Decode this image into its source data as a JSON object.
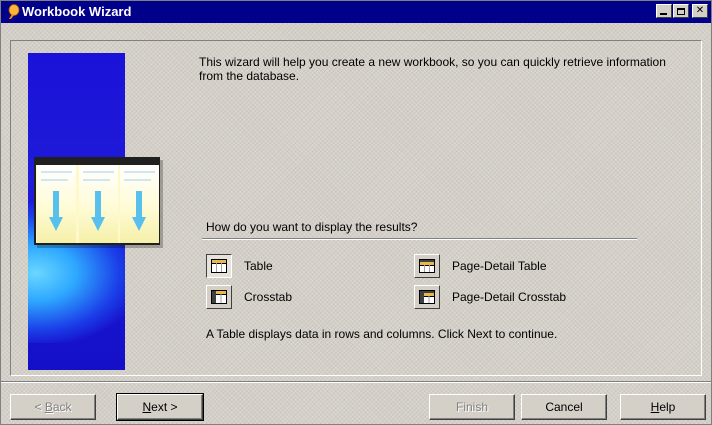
{
  "window": {
    "title": "Workbook Wizard",
    "controls": {
      "minimize": "_",
      "maximize": "□",
      "close": "×"
    }
  },
  "intro_text": "This wizard will help you create a new workbook, so you can quickly retrieve information from the database.",
  "question": "How do you want to display the results?",
  "options": [
    {
      "label": "Table",
      "icon": "table-layout-icon",
      "selected": true
    },
    {
      "label": "Page-Detail Table",
      "icon": "page-detail-table-icon",
      "selected": false
    },
    {
      "label": "Crosstab",
      "icon": "crosstab-layout-icon",
      "selected": false
    },
    {
      "label": "Page-Detail Crosstab",
      "icon": "page-detail-crosstab-icon",
      "selected": false
    }
  ],
  "hint": "A Table displays data in rows and columns. Click Next to continue.",
  "buttons": {
    "back": {
      "pre": "< ",
      "mn": "B",
      "post": "ack",
      "enabled": false
    },
    "next": {
      "pre": "",
      "mn": "N",
      "post": "ext >",
      "enabled": true
    },
    "finish": {
      "label": "Finish",
      "enabled": false
    },
    "cancel": {
      "label": "Cancel",
      "enabled": true
    },
    "help": {
      "pre": "",
      "mn": "H",
      "post": "elp",
      "enabled": true
    }
  },
  "colors": {
    "titlebar": "#00008b",
    "graphic_pane": "#1a12d8",
    "face": "#d4d0c8"
  }
}
